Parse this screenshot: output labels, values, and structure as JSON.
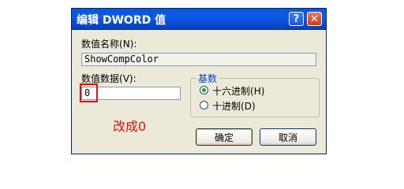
{
  "window": {
    "title": "编辑 DWORD 值",
    "help_glyph": "?",
    "close_glyph": "✕"
  },
  "value_name": {
    "label": "数值名称",
    "hotkey": "(N):",
    "value": "ShowCompColor"
  },
  "value_data": {
    "label": "数值数据",
    "hotkey": "(V):",
    "value": "0"
  },
  "base": {
    "title": "基数",
    "options": [
      {
        "label": "十六进制",
        "hotkey": "(H)",
        "selected": true
      },
      {
        "label": "十进制",
        "hotkey": "(D)",
        "selected": false
      }
    ]
  },
  "annotation": {
    "text": "改成0",
    "color": "#e01010"
  },
  "buttons": {
    "ok": "确定",
    "cancel": "取消"
  },
  "colors": {
    "titlebar": "#0b5ae6",
    "dialog_bg": "#ece9d8",
    "radio_dot": "#21a121",
    "highlight": "#e01010"
  }
}
